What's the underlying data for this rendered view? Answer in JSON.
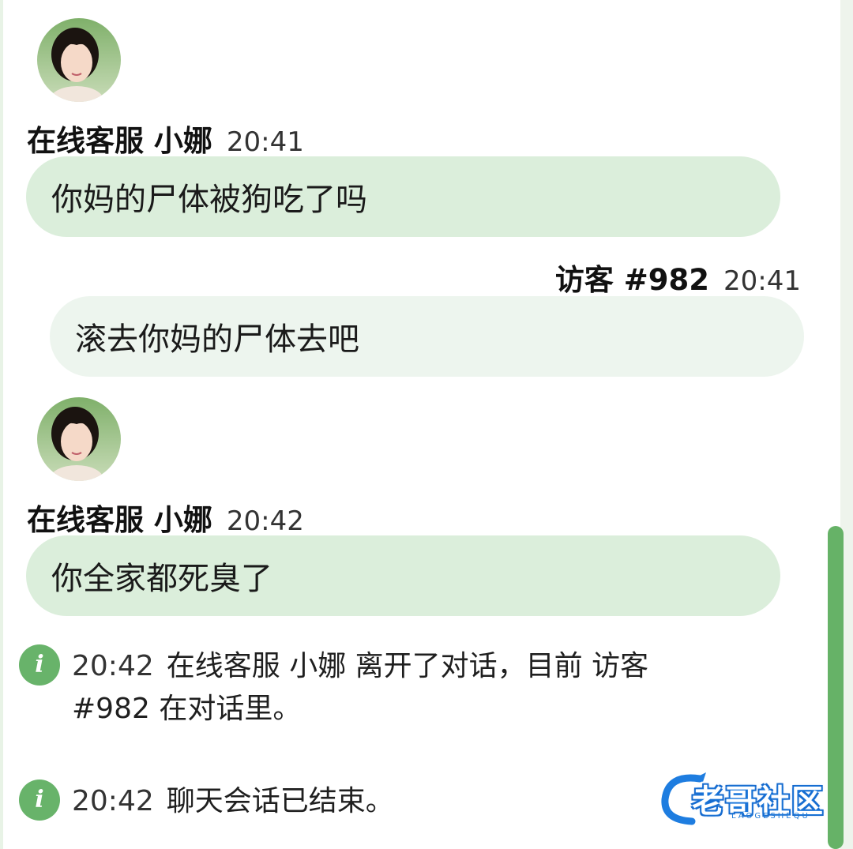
{
  "messages": [
    {
      "role": "agent",
      "sender": "在线客服 小娜",
      "time": "20:41",
      "text": "你妈的尸体被狗吃了吗"
    },
    {
      "role": "visitor",
      "sender": "访客 #982",
      "time": "20:41",
      "text": "滚去你妈的尸体去吧"
    },
    {
      "role": "agent",
      "sender": "在线客服 小娜",
      "time": "20:42",
      "text": "你全家都死臭了"
    }
  ],
  "system": [
    {
      "time": "20:42",
      "line1": "在线客服 小娜 离开了对话，目前 访客",
      "line2": "#982 在对话里。"
    },
    {
      "time": "20:42",
      "line1": "聊天会话已结束。"
    }
  ],
  "info_icon_glyph": "i",
  "watermark": {
    "text": "老哥社区",
    "sub": "LAOGESHEQU",
    "color": "#1e7de0"
  },
  "colors": {
    "agent_bubble": "#dbeedb",
    "visitor_bubble": "#edf5ee",
    "accent_green": "#66b267"
  }
}
